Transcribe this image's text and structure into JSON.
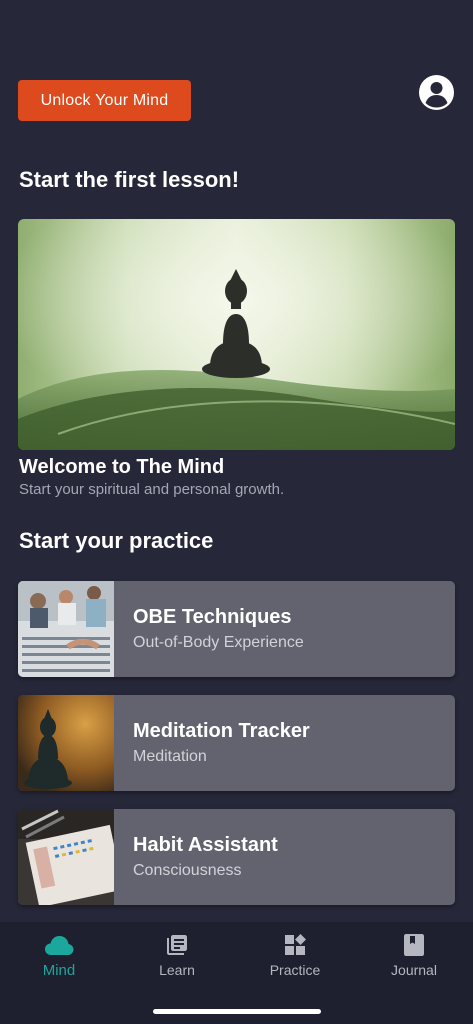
{
  "header": {
    "unlock_button_label": "Unlock Your Mind"
  },
  "hero_section": {
    "title": "Start the first lesson!",
    "card_title": "Welcome to The Mind",
    "card_subtitle": "Start your spiritual and personal growth."
  },
  "practice_section": {
    "title": "Start your practice",
    "items": [
      {
        "title": "OBE Techniques",
        "subtitle": "Out-of-Body Experience"
      },
      {
        "title": "Meditation Tracker",
        "subtitle": "Meditation"
      },
      {
        "title": "Habit Assistant",
        "subtitle": "Consciousness"
      }
    ]
  },
  "tabbar": {
    "tabs": [
      {
        "label": "Mind",
        "icon": "cloud-icon",
        "active": true
      },
      {
        "label": "Learn",
        "icon": "library-books-icon",
        "active": false
      },
      {
        "label": "Practice",
        "icon": "widgets-icon",
        "active": false
      },
      {
        "label": "Journal",
        "icon": "book-icon",
        "active": false
      }
    ]
  },
  "colors": {
    "background": "#262739",
    "accent_orange": "#dd4a1d",
    "active_tab": "#1ba79b",
    "card": "#636370"
  }
}
